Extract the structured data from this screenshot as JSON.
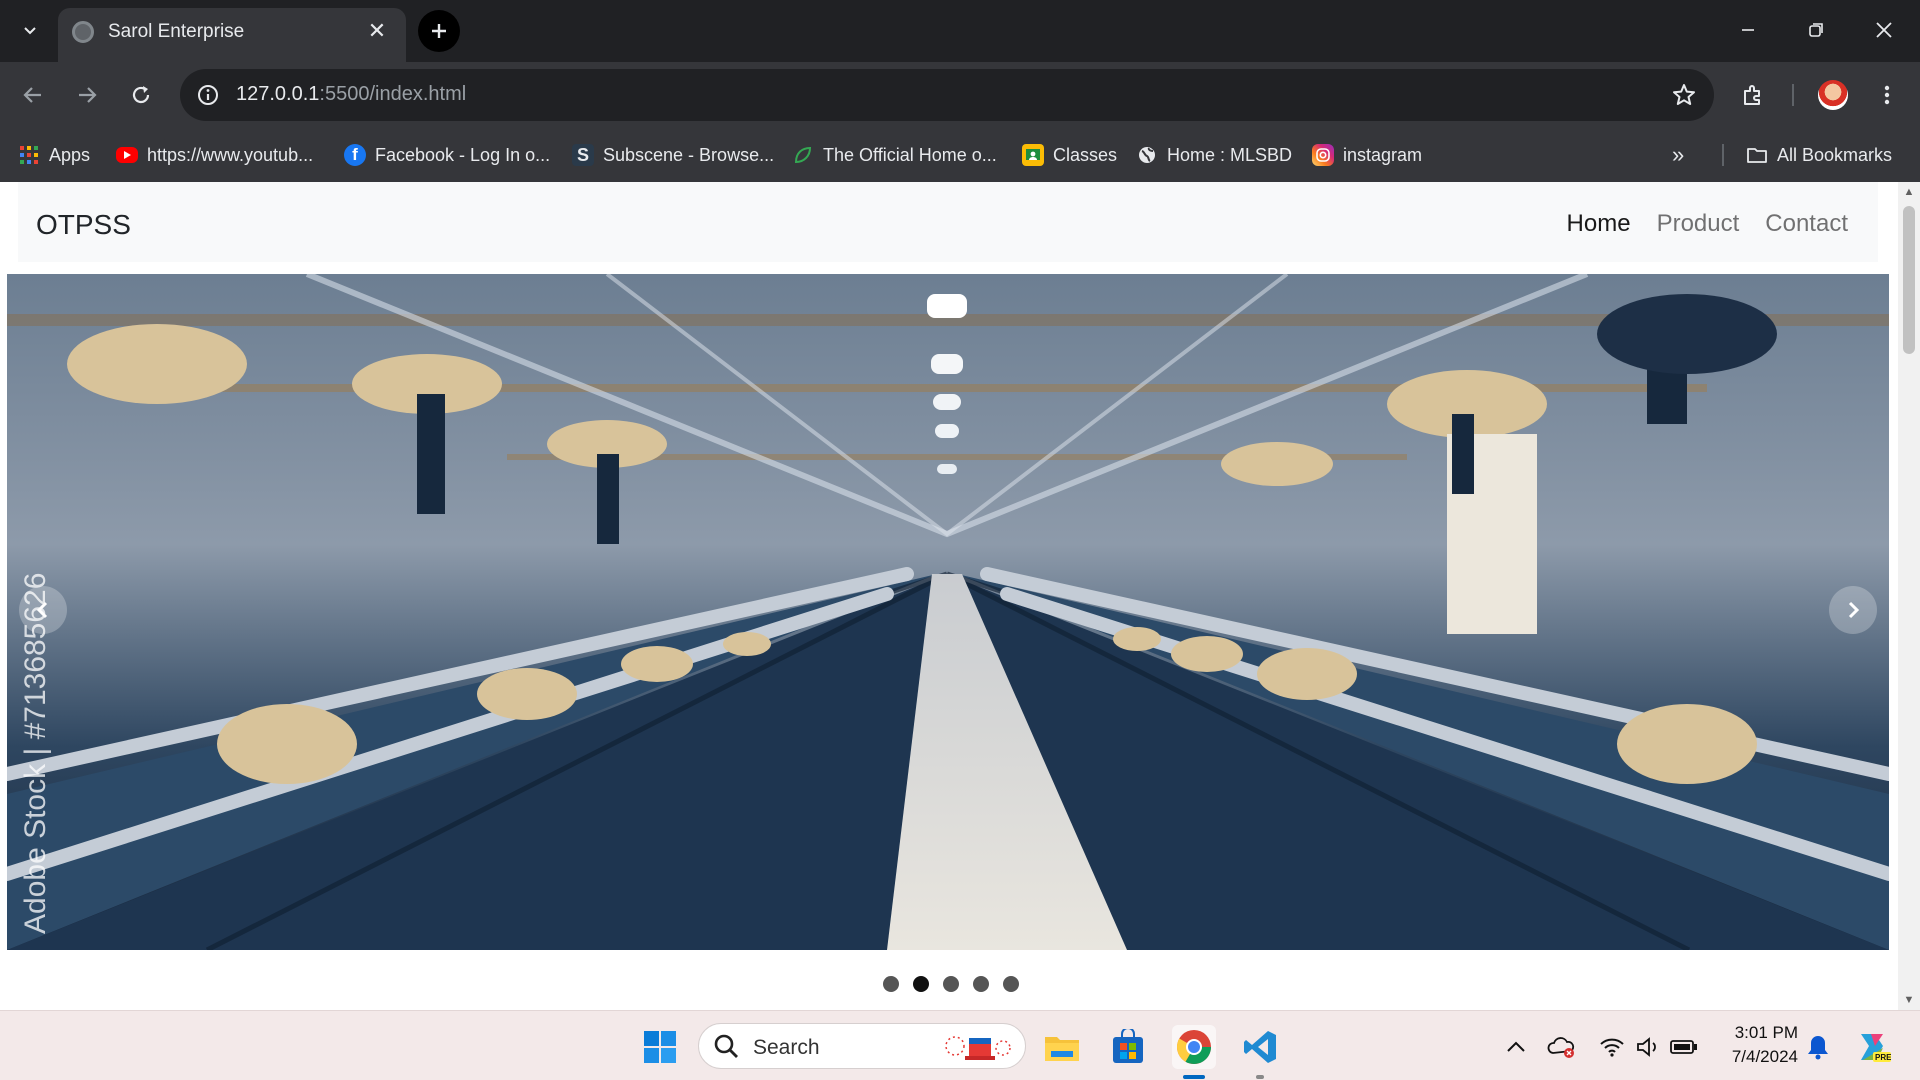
{
  "browser": {
    "tab": {
      "title": "Sarol Enterprise"
    },
    "url": {
      "host": "127.0.0.1",
      "path": ":5500/index.html"
    },
    "bookmarks": [
      {
        "label": "Apps",
        "icon": "apps-grid-icon"
      },
      {
        "label": "https://www.youtub...",
        "icon": "youtube-icon"
      },
      {
        "label": "Facebook - Log In o...",
        "icon": "facebook-icon"
      },
      {
        "label": "Subscene - Browse...",
        "icon": "subscene-icon"
      },
      {
        "label": "The Official Home o...",
        "icon": "leaf-icon"
      },
      {
        "label": "Classes",
        "icon": "classroom-icon"
      },
      {
        "label": "Home : MLSBD",
        "icon": "globe-icon"
      },
      {
        "label": "instagram",
        "icon": "instagram-icon"
      }
    ],
    "all_bookmarks": "All Bookmarks"
  },
  "site": {
    "brand": "OTPSS",
    "nav": [
      {
        "label": "Home",
        "active": true
      },
      {
        "label": "Product",
        "active": false
      },
      {
        "label": "Contact",
        "active": false
      }
    ],
    "carousel": {
      "watermark": "Adobe Stock | #713685626",
      "slide_count": 5,
      "active_index": 1
    }
  },
  "taskbar": {
    "search_placeholder": "Search",
    "time": "3:01 PM",
    "date": "7/4/2024"
  },
  "colors": {
    "chrome_dark": "#202124",
    "chrome_toolbar": "#35363a",
    "navbar_bg": "#f8f9fa",
    "taskbar_bg": "#f3e9e9"
  }
}
